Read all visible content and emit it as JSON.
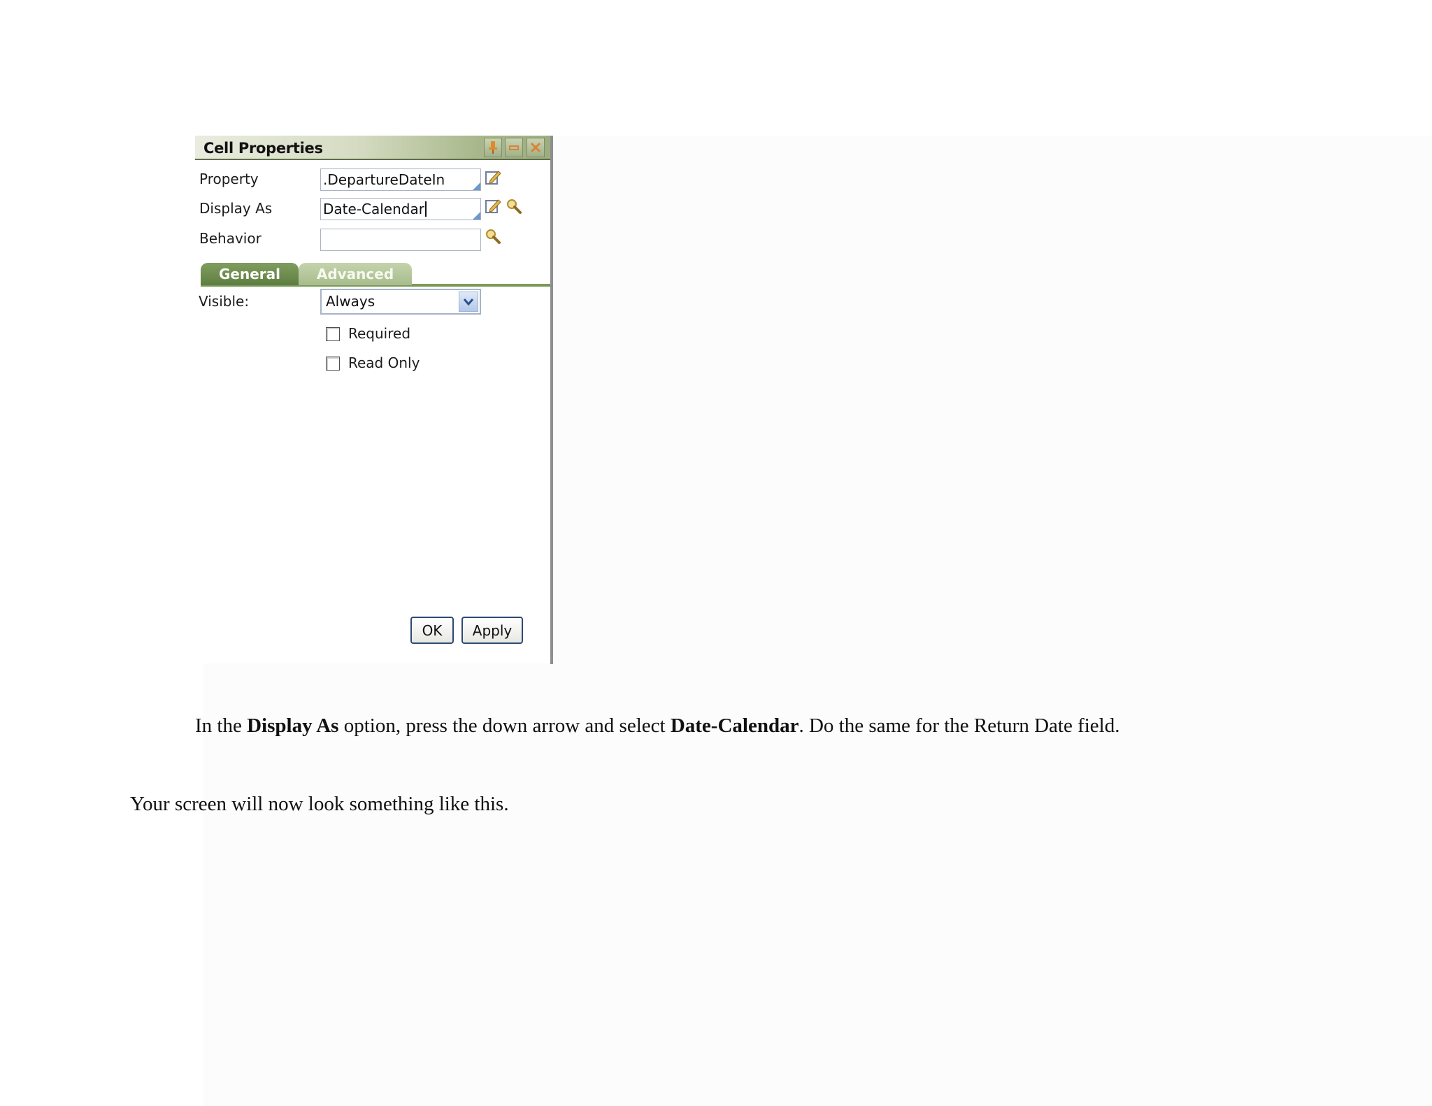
{
  "panel": {
    "title": "Cell Properties",
    "pin_glyph": "⬍",
    "min_glyph": "–",
    "close_glyph": "✕",
    "property_label": "Property",
    "property_value": ".DepartureDateIn",
    "display_as_label": "Display As",
    "display_as_value": "Date-Calendar",
    "behavior_label": "Behavior",
    "behavior_value": "",
    "tabs": [
      "General",
      "Advanced"
    ],
    "visible_label": "Visible:",
    "visible_value": "Always",
    "required_label": "Required",
    "read_only_label": "Read Only",
    "ok_label": "OK",
    "apply_label": "Apply"
  },
  "instruction": {
    "part1": "In the ",
    "bold1": "Display As",
    "part2": " option, press the down arrow and select ",
    "bold2": "Date-Calendar",
    "part3": ". Do the same for the Return Date field."
  },
  "followup": "Your screen will now look something like this.",
  "colors": {
    "tab_active": "#6a8a4c",
    "tab_inactive": "#b5c79a",
    "button_border": "#2e4a73"
  },
  "icons": [
    "pin-icon",
    "minimize-icon",
    "close-icon",
    "edit-icon",
    "magnifier-icon",
    "chevron-down-icon"
  ]
}
